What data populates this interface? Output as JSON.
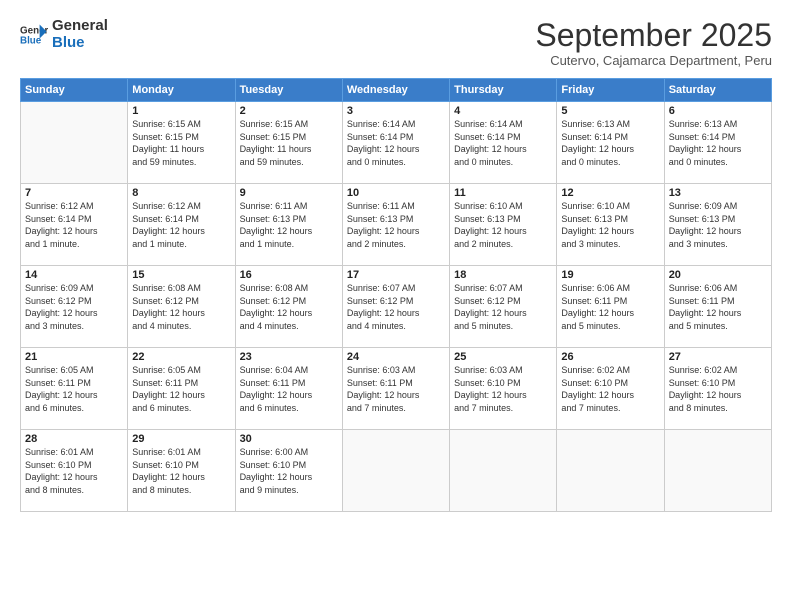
{
  "header": {
    "logo_line1": "General",
    "logo_line2": "Blue",
    "month_title": "September 2025",
    "subtitle": "Cutervo, Cajamarca Department, Peru"
  },
  "days_of_week": [
    "Sunday",
    "Monday",
    "Tuesday",
    "Wednesday",
    "Thursday",
    "Friday",
    "Saturday"
  ],
  "weeks": [
    [
      {
        "day": "",
        "detail": ""
      },
      {
        "day": "1",
        "detail": "Sunrise: 6:15 AM\nSunset: 6:15 PM\nDaylight: 11 hours\nand 59 minutes."
      },
      {
        "day": "2",
        "detail": "Sunrise: 6:15 AM\nSunset: 6:15 PM\nDaylight: 11 hours\nand 59 minutes."
      },
      {
        "day": "3",
        "detail": "Sunrise: 6:14 AM\nSunset: 6:14 PM\nDaylight: 12 hours\nand 0 minutes."
      },
      {
        "day": "4",
        "detail": "Sunrise: 6:14 AM\nSunset: 6:14 PM\nDaylight: 12 hours\nand 0 minutes."
      },
      {
        "day": "5",
        "detail": "Sunrise: 6:13 AM\nSunset: 6:14 PM\nDaylight: 12 hours\nand 0 minutes."
      },
      {
        "day": "6",
        "detail": "Sunrise: 6:13 AM\nSunset: 6:14 PM\nDaylight: 12 hours\nand 0 minutes."
      }
    ],
    [
      {
        "day": "7",
        "detail": "Sunrise: 6:12 AM\nSunset: 6:14 PM\nDaylight: 12 hours\nand 1 minute."
      },
      {
        "day": "8",
        "detail": "Sunrise: 6:12 AM\nSunset: 6:14 PM\nDaylight: 12 hours\nand 1 minute."
      },
      {
        "day": "9",
        "detail": "Sunrise: 6:11 AM\nSunset: 6:13 PM\nDaylight: 12 hours\nand 1 minute."
      },
      {
        "day": "10",
        "detail": "Sunrise: 6:11 AM\nSunset: 6:13 PM\nDaylight: 12 hours\nand 2 minutes."
      },
      {
        "day": "11",
        "detail": "Sunrise: 6:10 AM\nSunset: 6:13 PM\nDaylight: 12 hours\nand 2 minutes."
      },
      {
        "day": "12",
        "detail": "Sunrise: 6:10 AM\nSunset: 6:13 PM\nDaylight: 12 hours\nand 3 minutes."
      },
      {
        "day": "13",
        "detail": "Sunrise: 6:09 AM\nSunset: 6:13 PM\nDaylight: 12 hours\nand 3 minutes."
      }
    ],
    [
      {
        "day": "14",
        "detail": "Sunrise: 6:09 AM\nSunset: 6:12 PM\nDaylight: 12 hours\nand 3 minutes."
      },
      {
        "day": "15",
        "detail": "Sunrise: 6:08 AM\nSunset: 6:12 PM\nDaylight: 12 hours\nand 4 minutes."
      },
      {
        "day": "16",
        "detail": "Sunrise: 6:08 AM\nSunset: 6:12 PM\nDaylight: 12 hours\nand 4 minutes."
      },
      {
        "day": "17",
        "detail": "Sunrise: 6:07 AM\nSunset: 6:12 PM\nDaylight: 12 hours\nand 4 minutes."
      },
      {
        "day": "18",
        "detail": "Sunrise: 6:07 AM\nSunset: 6:12 PM\nDaylight: 12 hours\nand 5 minutes."
      },
      {
        "day": "19",
        "detail": "Sunrise: 6:06 AM\nSunset: 6:11 PM\nDaylight: 12 hours\nand 5 minutes."
      },
      {
        "day": "20",
        "detail": "Sunrise: 6:06 AM\nSunset: 6:11 PM\nDaylight: 12 hours\nand 5 minutes."
      }
    ],
    [
      {
        "day": "21",
        "detail": "Sunrise: 6:05 AM\nSunset: 6:11 PM\nDaylight: 12 hours\nand 6 minutes."
      },
      {
        "day": "22",
        "detail": "Sunrise: 6:05 AM\nSunset: 6:11 PM\nDaylight: 12 hours\nand 6 minutes."
      },
      {
        "day": "23",
        "detail": "Sunrise: 6:04 AM\nSunset: 6:11 PM\nDaylight: 12 hours\nand 6 minutes."
      },
      {
        "day": "24",
        "detail": "Sunrise: 6:03 AM\nSunset: 6:11 PM\nDaylight: 12 hours\nand 7 minutes."
      },
      {
        "day": "25",
        "detail": "Sunrise: 6:03 AM\nSunset: 6:10 PM\nDaylight: 12 hours\nand 7 minutes."
      },
      {
        "day": "26",
        "detail": "Sunrise: 6:02 AM\nSunset: 6:10 PM\nDaylight: 12 hours\nand 7 minutes."
      },
      {
        "day": "27",
        "detail": "Sunrise: 6:02 AM\nSunset: 6:10 PM\nDaylight: 12 hours\nand 8 minutes."
      }
    ],
    [
      {
        "day": "28",
        "detail": "Sunrise: 6:01 AM\nSunset: 6:10 PM\nDaylight: 12 hours\nand 8 minutes."
      },
      {
        "day": "29",
        "detail": "Sunrise: 6:01 AM\nSunset: 6:10 PM\nDaylight: 12 hours\nand 8 minutes."
      },
      {
        "day": "30",
        "detail": "Sunrise: 6:00 AM\nSunset: 6:10 PM\nDaylight: 12 hours\nand 9 minutes."
      },
      {
        "day": "",
        "detail": ""
      },
      {
        "day": "",
        "detail": ""
      },
      {
        "day": "",
        "detail": ""
      },
      {
        "day": "",
        "detail": ""
      }
    ]
  ]
}
